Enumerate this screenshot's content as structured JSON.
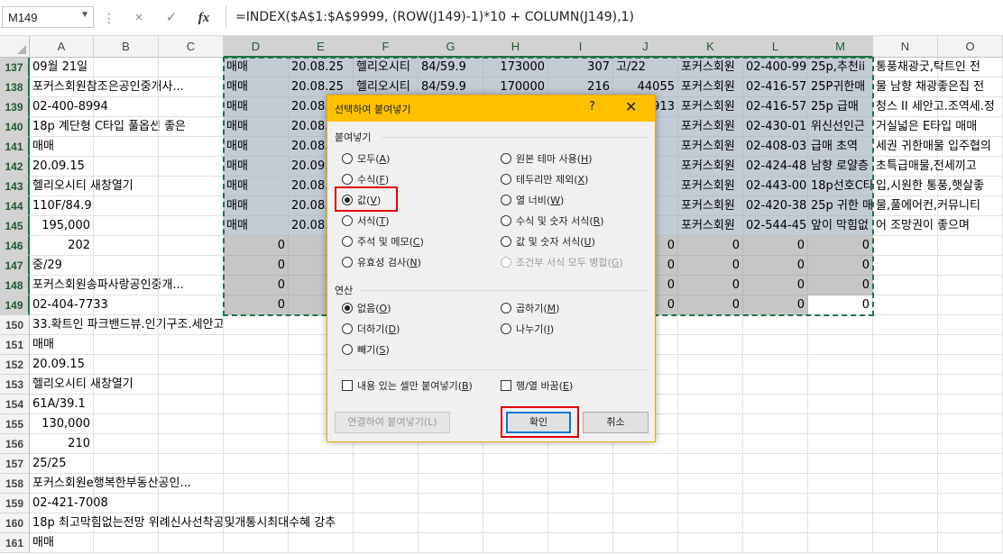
{
  "formula_bar": {
    "name_box": "M149",
    "cancel_icon": "×",
    "enter_icon": "✓",
    "fx_label": "fx",
    "formula": "=INDEX($A$1:$A$9999, (ROW(J149)-1)*10 + COLUMN(J149),1)"
  },
  "columns": [
    "A",
    "B",
    "C",
    "D",
    "E",
    "F",
    "G",
    "H",
    "I",
    "J",
    "K",
    "L",
    "M",
    "N",
    "O"
  ],
  "rows": [
    "137",
    "138",
    "139",
    "140",
    "141",
    "142",
    "143",
    "144",
    "145",
    "146",
    "147",
    "148",
    "149",
    "150",
    "151",
    "152",
    "153",
    "154",
    "155",
    "156",
    "157",
    "158",
    "159",
    "160",
    "161"
  ],
  "col_a": [
    "09월 21일",
    "포커스회원참조은공인중개사...",
    "02-400-8994",
    "18p 계단형 C타입 풀옵션 좋은",
    "매매",
    "20.09.15",
    "헬리오시티 새창열기",
    "110F/84.9",
    "195,000",
    "202",
    "중/29",
    "포커스회원송파사랑공인중개...",
    "02-404-7733",
    "33.확트인 파크밴드뷰.인기구조.세안고",
    "매매",
    "20.09.15",
    "헬리오시티 새창열기",
    "61A/39.1",
    "130,000",
    "210",
    "25/25",
    "포커스회원e행복한부동산공인...",
    "02-421-7008",
    "18p 최고막힘없는전망 위례신사선착공및개통시최대수혜 강추",
    "매매"
  ],
  "sheet_rows": [
    {
      "D": "매매",
      "E": "20.08.25",
      "F": "헬리오시티",
      "G": "84/59.9",
      "H": "173000",
      "I": "307",
      "J": "고/22",
      "K": "포커스회원",
      "L": "02-400-99",
      "M": "25p,추천ii",
      "N": "통풍채광굿,탁트인 전"
    },
    {
      "D": "매매",
      "E": "20.08.25",
      "F": "헬리오시티",
      "G": "84/59.9",
      "H": "170000",
      "I": "216",
      "J": "44055",
      "K": "포커스회원",
      "L": "02-416-57",
      "M": "25P귀한매",
      "N": "물 남향 채광좋은집 전"
    },
    {
      "D": "매매",
      "E": "20.08.",
      "F": "",
      "G": "",
      "H": "",
      "I": "",
      "J": "913",
      "K": "포커스회원",
      "L": "02-416-57",
      "M": "25p 급매",
      "N": "청스 II 세안고.조역세.정"
    },
    {
      "D": "매매",
      "E": "20.08.",
      "K": "포커스회원",
      "L": "02-430-01",
      "M": "위신선인근",
      "N": "거실넓은 E타입 매매"
    },
    {
      "D": "매매",
      "E": "20.08.",
      "K": "포커스회원",
      "L": "02-408-03",
      "M": "급매 초역",
      "N": "세권 귀한매물 입주협의"
    },
    {
      "D": "매매",
      "E": "20.09.",
      "K": "포커스회원",
      "L": "02-424-48",
      "M": "남향 로얄층",
      "N": "초특급매물,전세끼고"
    },
    {
      "D": "매매",
      "E": "20.08.",
      "K": "포커스회원",
      "L": "02-443-00",
      "M": "18p선호C타",
      "N": "입,시원한 통풍,햇살좋"
    },
    {
      "D": "매매",
      "E": "20.08.",
      "K": "포커스회원",
      "L": "02-420-38",
      "M": "25p 귀한 매",
      "N": "물,풀에어컨,커뮤니티"
    },
    {
      "D": "매매",
      "E": "20.08.",
      "K": "포커스회원",
      "L": "02-544-45",
      "M": "앞이 막힘없",
      "N": "어 조망권이 좋으며"
    },
    {
      "D": "0",
      "J": "0",
      "K": "0",
      "L": "0",
      "M": "0"
    },
    {
      "D": "0",
      "J": "0",
      "K": "0",
      "L": "0",
      "M": "0"
    },
    {
      "D": "0",
      "J": "0",
      "K": "0",
      "L": "0",
      "M": "0"
    },
    {
      "D": "0",
      "J": "0",
      "K": "0",
      "L": "0",
      "M": "0"
    }
  ],
  "dialog": {
    "title": "선택하여 붙여넣기",
    "help_icon": "?",
    "close_icon": "✕",
    "paste_group": "붙여넣기",
    "paste_options_left": [
      {
        "label": "모두(",
        "key": "A",
        "checked": false
      },
      {
        "label": "수식(",
        "key": "F",
        "checked": false
      },
      {
        "label": "값(",
        "key": "V",
        "checked": true
      },
      {
        "label": "서식(",
        "key": "T",
        "checked": false
      },
      {
        "label": "주석 및 메모(",
        "key": "C",
        "checked": false
      },
      {
        "label": "유효성 검사(",
        "key": "N",
        "checked": false
      }
    ],
    "paste_options_right": [
      {
        "label": "원본 테마 사용(",
        "key": "H",
        "checked": false
      },
      {
        "label": "테두리만 제외(",
        "key": "X",
        "checked": false
      },
      {
        "label": "열 너비(",
        "key": "W",
        "checked": false
      },
      {
        "label": "수식 및 숫자 서식(",
        "key": "R",
        "checked": false
      },
      {
        "label": "값 및 숫자 서식(",
        "key": "U",
        "checked": false
      },
      {
        "label": "조건부 서식 모두 병합(",
        "key": "G",
        "checked": false,
        "disabled": true
      }
    ],
    "operation_group": "연산",
    "operation_left": [
      {
        "label": "없음(",
        "key": "O",
        "checked": true
      },
      {
        "label": "더하기(",
        "key": "D",
        "checked": false
      },
      {
        "label": "빼기(",
        "key": "S",
        "checked": false
      }
    ],
    "operation_right": [
      {
        "label": "곱하기(",
        "key": "M",
        "checked": false
      },
      {
        "label": "나누기(",
        "key": "I",
        "checked": false
      }
    ],
    "skip_blanks": {
      "label": "내용 있는 셀만 붙여넣기(",
      "key": "B"
    },
    "transpose": {
      "label": "행/열 바꿈(",
      "key": "E"
    },
    "paste_link_button": "연결하여 붙여넣기(L)",
    "ok_button": "확인",
    "cancel_button": "취소"
  },
  "colors": {
    "accent": "#217346",
    "dialog_title": "#ffc000",
    "highlight": "#e00000"
  }
}
